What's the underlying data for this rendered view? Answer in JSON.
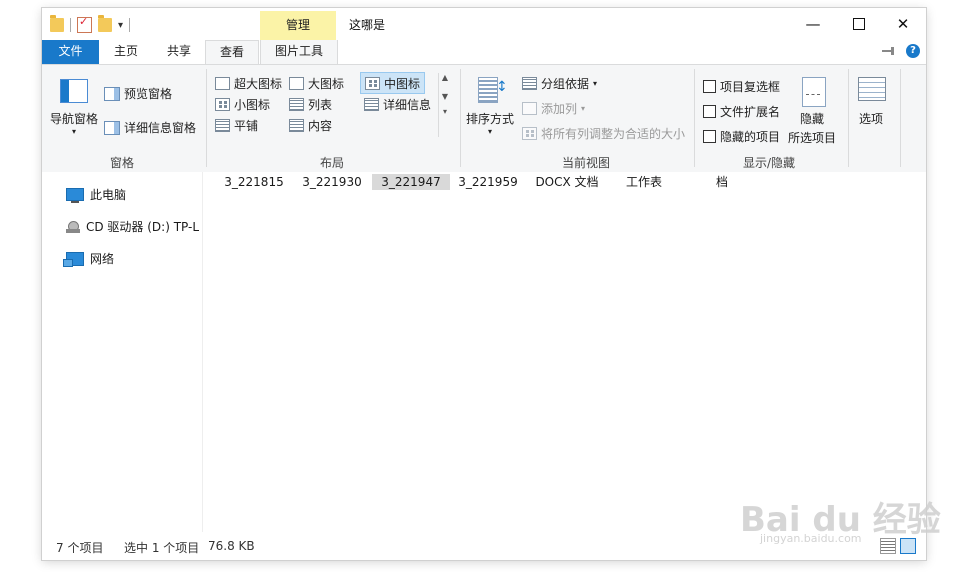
{
  "window": {
    "title": "这哪是",
    "context_tab": "管理"
  },
  "ribbon_tabs": [
    {
      "label": "文件"
    },
    {
      "label": "主页"
    },
    {
      "label": "共享"
    },
    {
      "label": "查看"
    },
    {
      "label": "图片工具"
    }
  ],
  "groups": {
    "panes": {
      "label": "窗格",
      "nav_pane": "导航窗格",
      "preview_pane": "预览窗格",
      "details_pane": "详细信息窗格"
    },
    "layout": {
      "label": "布局",
      "extra_large": "超大图标",
      "large": "大图标",
      "medium": "中图标",
      "small": "小图标",
      "list": "列表",
      "details": "详细信息",
      "tiles": "平铺",
      "content": "内容"
    },
    "current_view": {
      "label": "当前视图",
      "sort_by": "排序方式",
      "group_by": "分组依据",
      "add_column": "添加列",
      "fit_columns": "将所有列调整为合适的大小"
    },
    "show_hide": {
      "label": "显示/隐藏",
      "item_checkboxes": "项目复选框",
      "file_extensions": "文件扩展名",
      "hidden_items": "隐藏的项目",
      "hide_selected_1": "隐藏",
      "hide_selected_2": "所选项目"
    },
    "options": {
      "label": "选项"
    }
  },
  "nav": {
    "items": [
      {
        "label": "此电脑"
      },
      {
        "label": "CD 驱动器 (D:) TP-L"
      },
      {
        "label": "网络"
      }
    ]
  },
  "files": [
    {
      "label": "3_221815"
    },
    {
      "label": "3_221930"
    },
    {
      "label": "3_221947"
    },
    {
      "label": "3_221959"
    },
    {
      "label": "DOCX 文档"
    },
    {
      "label": "工作表"
    },
    {
      "label": "档"
    }
  ],
  "status": {
    "count": "7 个项目",
    "selected": "选中 1 个项目",
    "size": "76.8 KB"
  },
  "watermark": {
    "main": "Bai du 经验",
    "sub": "jingyan.baidu.com"
  },
  "colors": {
    "accent": "#1979ca",
    "manage_tab": "#fbf3a7",
    "ribbon_bg": "#f5f6f7"
  }
}
